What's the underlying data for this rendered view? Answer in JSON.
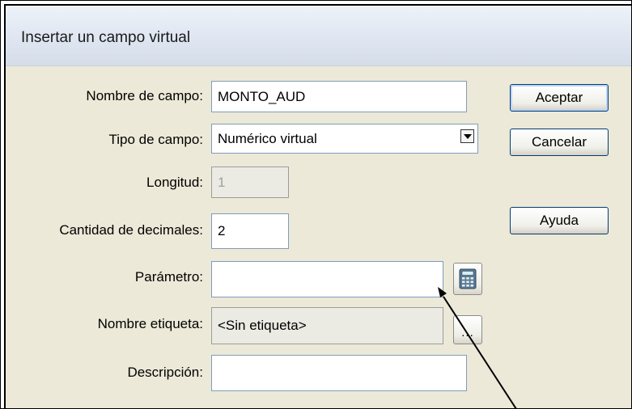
{
  "dialog": {
    "title": "Insertar un campo virtual"
  },
  "form": {
    "nombre_label": "Nombre de campo:",
    "nombre_value": "MONTO_AUD",
    "tipo_label": "Tipo de campo:",
    "tipo_value": "Numérico virtual",
    "longitud_label": "Longitud:",
    "longitud_value": "1",
    "decimales_label": "Cantidad de decimales:",
    "decimales_value": "2",
    "parametro_label": "Parámetro:",
    "parametro_value": "",
    "etiqueta_label": "Nombre etiqueta:",
    "etiqueta_value": "<Sin etiqueta>",
    "descripcion_label": "Descripción:",
    "descripcion_value": ""
  },
  "buttons": {
    "accept": "Aceptar",
    "cancel": "Cancelar",
    "help": "Ayuda",
    "ellipsis": "..."
  },
  "icons": {
    "calculator": "calculator-icon",
    "dropdown": "chevron-down-icon",
    "annotation": "annotation-arrow"
  }
}
